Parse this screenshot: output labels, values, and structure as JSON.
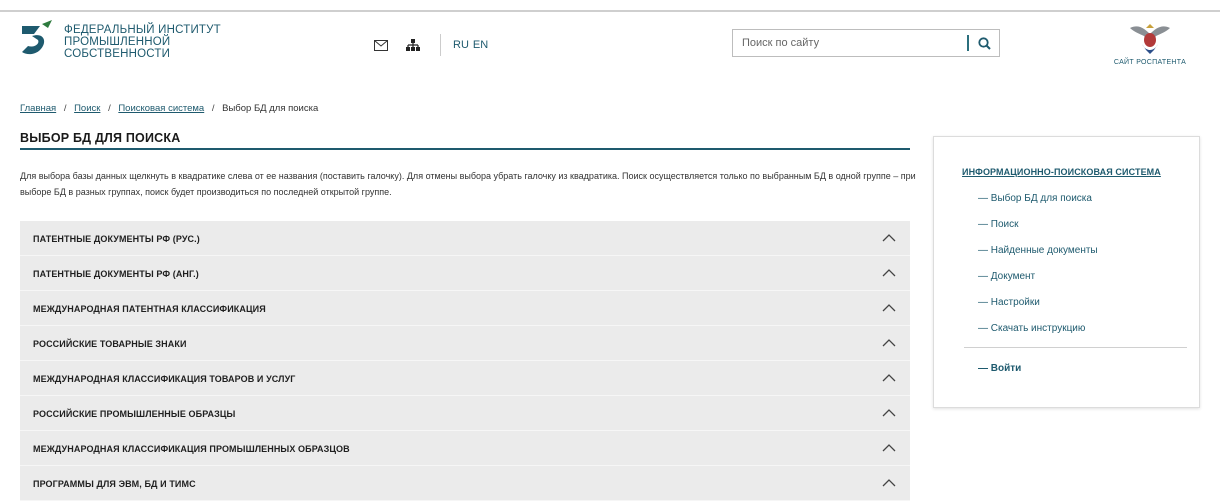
{
  "header": {
    "logo_lines": [
      "ФЕДЕРАЛЬНЫЙ ИНСТИТУТ",
      "ПРОМЫШЛЕННОЙ",
      "СОБСТВЕННОСТИ"
    ],
    "lang_ru": "RU",
    "lang_en": "EN",
    "search_placeholder": "Поиск по сайту",
    "rospatent_label": "САЙТ РОСПАТЕНТА"
  },
  "breadcrumb": {
    "items": [
      "Главная",
      "Поиск",
      "Поисковая система"
    ],
    "current": "Выбор БД для поиска",
    "separator": "/"
  },
  "page": {
    "title": "ВЫБОР БД ДЛЯ ПОИСКА",
    "description": "Для выбора базы данных щелкнуть в квадратике слева от ее названия (поставить галочку). Для отмены выбора убрать галочку из квадратика. Поиск осуществляется только по выбранным БД в одной группе – при выборе БД в разных группах, поиск будет производиться по последней открытой группе."
  },
  "db_groups": [
    "ПАТЕНТНЫЕ ДОКУМЕНТЫ РФ (РУС.)",
    "ПАТЕНТНЫЕ ДОКУМЕНТЫ РФ (АНГ.)",
    "МЕЖДУНАРОДНАЯ ПАТЕНТНАЯ КЛАССИФИКАЦИЯ",
    "РОССИЙСКИЕ ТОВАРНЫЕ ЗНАКИ",
    "МЕЖДУНАРОДНАЯ КЛАССИФИКАЦИЯ ТОВАРОВ И УСЛУГ",
    "РОССИЙСКИЕ ПРОМЫШЛЕННЫЕ ОБРАЗЦЫ",
    "МЕЖДУНАРОДНАЯ КЛАССИФИКАЦИЯ ПРОМЫШЛЕННЫХ ОБРАЗЦОВ",
    "ПРОГРАММЫ ДЛЯ ЭВМ, БД И ТИМС"
  ],
  "sidebar": {
    "title": "ИНФОРМАЦИОННО-ПОИСКОВАЯ СИСТЕМА",
    "items": [
      "— Выбор БД для поиска",
      "— Поиск",
      "— Найденные документы",
      "— Документ",
      "— Настройки",
      "— Скачать инструкцию"
    ],
    "login": "— Войти"
  },
  "colors": {
    "accent": "#1e5a6e",
    "panel_bg": "#ebebeb"
  },
  "icons": [
    "logo-icon",
    "mail-icon",
    "sitemap-icon",
    "search-icon",
    "rospatent-emblem-icon",
    "chevron-up-icon"
  ]
}
